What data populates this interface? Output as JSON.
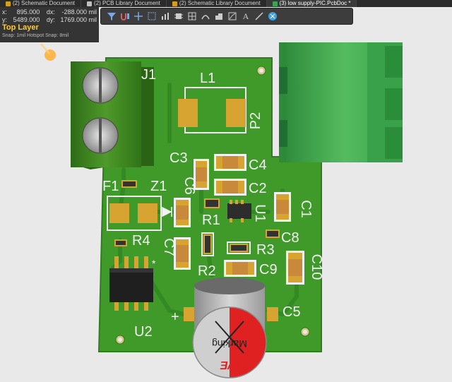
{
  "tabs": [
    {
      "label": "(2) Schematic Document",
      "icon": "schematic-doc-icon",
      "color": "#d4a017"
    },
    {
      "label": "(2) PCB Library Document",
      "icon": "pcblib-doc-icon",
      "color": "#c0c0c0"
    },
    {
      "label": "(2) Schematic Library Document",
      "icon": "schlib-doc-icon",
      "color": "#d4a017"
    },
    {
      "label": "(3) low supply-PIC.PcbDoc *",
      "icon": "pcb-doc-icon",
      "color": "#3aa655"
    }
  ],
  "toolbar": {
    "tools": [
      "filter-icon",
      "route-icon",
      "crosshair-icon",
      "select-rect-icon",
      "chart-icon",
      "component-icon",
      "grid-icon",
      "arc-icon",
      "region-icon",
      "graph-icon",
      "text-icon",
      "line-icon",
      "3d-icon"
    ]
  },
  "hud": {
    "x_label": "x:",
    "x_value": "895.000",
    "dx_label": "dx:",
    "dx_value": "-288.000 mil",
    "y_label": "y:",
    "y_value": "5489.000",
    "dy_label": "dy:",
    "dy_value": "1769.000 mil",
    "layer": "Top Layer",
    "snap": "Snap: 1mil Hotspot Snap: 8mil"
  },
  "designators": {
    "j1": "J1",
    "l1": "L1",
    "p2": "P2",
    "c3": "C3",
    "c4": "C4",
    "c6": "C6",
    "c2": "C2",
    "f1": "F1",
    "z1": "Z1",
    "r1": "R1",
    "u1": "U1",
    "c1": "C1",
    "c8": "C8",
    "r4": "R4",
    "c7": "C7",
    "r3": "R3",
    "c10": "C10",
    "c9": "C9",
    "r2": "R2",
    "c5": "C5",
    "u2": "U2",
    "plus": "+"
  },
  "capacitor_marking": {
    "text": "Marking",
    "brand": "WE"
  },
  "colors": {
    "board": "#3f9a2a",
    "silk": "#f2f2f2",
    "pad": "#d7a431",
    "connector": "#3aa14b"
  }
}
